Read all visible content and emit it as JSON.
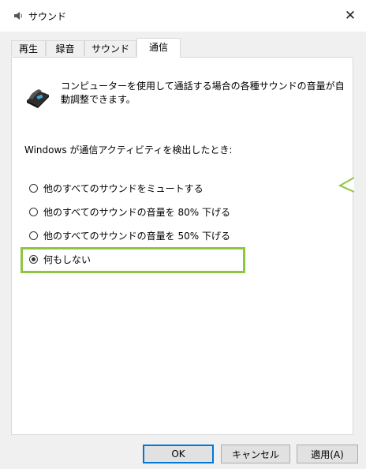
{
  "window": {
    "title": "サウンド",
    "close_symbol": "✕"
  },
  "tabs": [
    {
      "label": "再生",
      "active": false
    },
    {
      "label": "録音",
      "active": false
    },
    {
      "label": "サウンド",
      "active": false
    },
    {
      "label": "通信",
      "active": true
    }
  ],
  "communications": {
    "description": "コンピューターを使用して通話する場合の各種サウンドの音量が自動調整できます。",
    "detect_label": "Windows が通信アクティビティを検出したとき:",
    "options": [
      {
        "label": "他のすべてのサウンドをミュートする",
        "checked": false
      },
      {
        "label": "他のすべてのサウンドの音量を 80% 下げる",
        "checked": false
      },
      {
        "label": "他のすべてのサウンドの音量を 50% 下げる",
        "checked": false
      },
      {
        "label": "何もしない",
        "checked": true
      }
    ],
    "highlight_color": "#8ec63f"
  },
  "buttons": {
    "ok": "OK",
    "cancel": "キャンセル",
    "apply": "適用(A)"
  },
  "icons": {
    "title": "speaker-icon",
    "phone": "telephone-icon"
  }
}
